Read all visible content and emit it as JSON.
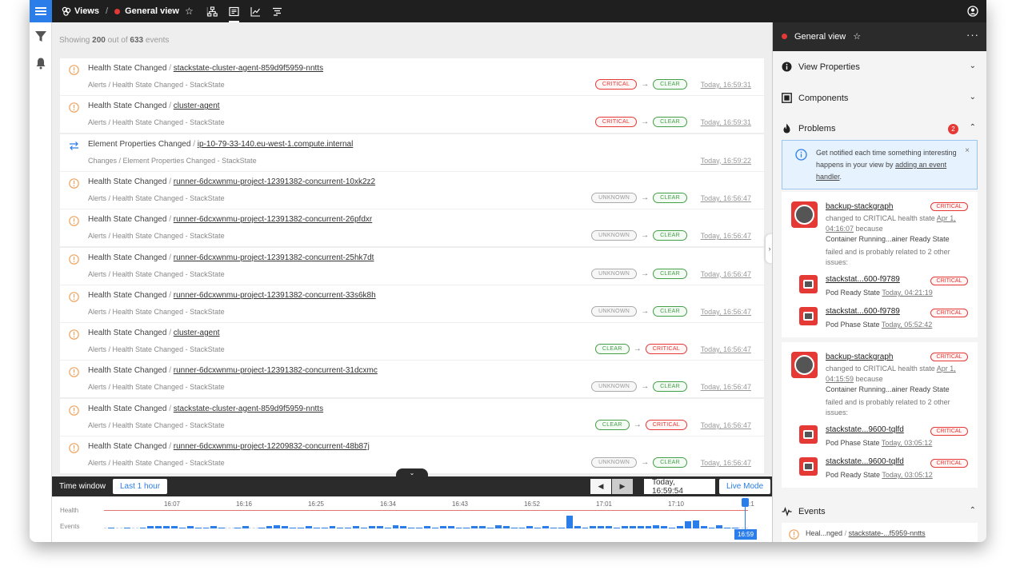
{
  "topbar": {
    "views_label": "Views",
    "separator": "/",
    "view_name": "General view",
    "divider": "|"
  },
  "main": {
    "showing_prefix": "Showing",
    "showing_count": "200",
    "showing_mid": "out of",
    "showing_total": "633",
    "showing_suffix": "events",
    "events": [
      {
        "icon": "warning-icon",
        "type": "Health State Changed",
        "sep": "/",
        "target": "stackstate-cluster-agent-859d9f5959-nntts",
        "subtitle": "Alerts / Health State Changed - StackState",
        "from": "CRITICAL",
        "arrow": "→",
        "to": "CLEAR",
        "time": "Today, 16:59:31"
      },
      {
        "icon": "warning-icon",
        "type": "Health State Changed",
        "sep": "/",
        "target": "cluster-agent",
        "subtitle": "Alerts / Health State Changed - StackState",
        "from": "CRITICAL",
        "arrow": "→",
        "to": "CLEAR",
        "time": "Today, 16:59:31"
      },
      {
        "icon": "swap-icon",
        "type": "Element Properties Changed",
        "sep": "/",
        "target": "ip-10-79-33-140.eu-west-1.compute.internal",
        "subtitle": "Changes / Element Properties Changed - StackState",
        "from": "",
        "arrow": "",
        "to": "",
        "time": "Today, 16:59:22"
      },
      {
        "icon": "warning-icon",
        "type": "Health State Changed",
        "sep": "/",
        "target": "runner-6dcxwnmu-project-12391382-concurrent-10xk2z2",
        "subtitle": "Alerts / Health State Changed - StackState",
        "from": "UNKNOWN",
        "arrow": "→",
        "to": "CLEAR",
        "time": "Today, 16:56:47"
      },
      {
        "icon": "warning-icon",
        "type": "Health State Changed",
        "sep": "/",
        "target": "runner-6dcxwnmu-project-12391382-concurrent-26pfdxr",
        "subtitle": "Alerts / Health State Changed - StackState",
        "from": "UNKNOWN",
        "arrow": "→",
        "to": "CLEAR",
        "time": "Today, 16:56:47"
      },
      {
        "icon": "warning-icon",
        "type": "Health State Changed",
        "sep": "/",
        "target": "runner-6dcxwnmu-project-12391382-concurrent-25hk7dt",
        "subtitle": "Alerts / Health State Changed - StackState",
        "from": "UNKNOWN",
        "arrow": "→",
        "to": "CLEAR",
        "time": "Today, 16:56:47"
      },
      {
        "icon": "warning-icon",
        "type": "Health State Changed",
        "sep": "/",
        "target": "runner-6dcxwnmu-project-12391382-concurrent-33s6k8h",
        "subtitle": "Alerts / Health State Changed - StackState",
        "from": "UNKNOWN",
        "arrow": "→",
        "to": "CLEAR",
        "time": "Today, 16:56:47"
      },
      {
        "icon": "warning-icon",
        "type": "Health State Changed",
        "sep": "/",
        "target": "cluster-agent",
        "subtitle": "Alerts / Health State Changed - StackState",
        "from": "CLEAR",
        "arrow": "→",
        "to": "CRITICAL",
        "time": "Today, 16:56:47"
      },
      {
        "icon": "warning-icon",
        "type": "Health State Changed",
        "sep": "/",
        "target": "runner-6dcxwnmu-project-12391382-concurrent-31dcxmc",
        "subtitle": "Alerts / Health State Changed - StackState",
        "from": "UNKNOWN",
        "arrow": "→",
        "to": "CLEAR",
        "time": "Today, 16:56:47"
      },
      {
        "icon": "warning-icon",
        "type": "Health State Changed",
        "sep": "/",
        "target": "stackstate-cluster-agent-859d9f5959-nntts",
        "subtitle": "Alerts / Health State Changed - StackState",
        "from": "CLEAR",
        "arrow": "→",
        "to": "CRITICAL",
        "time": "Today, 16:56:47"
      },
      {
        "icon": "warning-icon",
        "type": "Health State Changed",
        "sep": "/",
        "target": "runner-6dcxwnmu-project-12209832-concurrent-48b87j",
        "subtitle": "Alerts / Health State Changed - StackState",
        "from": "UNKNOWN",
        "arrow": "→",
        "to": "CLEAR",
        "time": "Today, 16:56:47"
      }
    ]
  },
  "timewindow": {
    "label": "Time window",
    "range": "Last 1 hour",
    "current_time": "Today, 16:59:54",
    "mode": "Live Mode",
    "prev": "◀",
    "next": "▶",
    "collapse": "⌄"
  },
  "timeline": {
    "health_label": "Health",
    "events_label": "Events",
    "ticks": [
      "16:07",
      "16:16",
      "16:25",
      "16:34",
      "16:43",
      "16:52",
      "17:01",
      "17:10",
      "17:1"
    ],
    "cursor_time": "16:59",
    "event_counts": [
      1,
      0,
      1,
      0,
      1,
      2,
      2,
      2,
      2,
      1,
      2,
      1,
      1,
      2,
      1,
      0,
      1,
      2,
      0,
      1,
      2,
      3,
      2,
      1,
      1,
      2,
      1,
      1,
      2,
      1,
      1,
      2,
      1,
      2,
      2,
      1,
      3,
      2,
      1,
      1,
      2,
      1,
      2,
      2,
      1,
      1,
      2,
      2,
      1,
      3,
      2,
      1,
      1,
      2,
      1,
      2,
      1,
      1,
      12,
      2,
      1,
      2,
      2,
      2,
      1,
      2,
      2,
      2,
      2,
      3,
      2,
      1,
      2,
      7,
      8,
      2,
      1,
      3,
      1,
      1
    ]
  },
  "panel": {
    "view_name": "General view",
    "more": "···",
    "sections": {
      "view_properties": "View Properties",
      "components": "Components",
      "problems": "Problems",
      "problems_count": "2",
      "events": "Events"
    },
    "notice": {
      "text": "Get notified each time something interesting happens in your view by",
      "link": "adding an event handler",
      "end": ".",
      "close": "×"
    },
    "problems": [
      {
        "name": "backup-stackgraph",
        "badge": "CRITICAL",
        "line1": "changed to CRITICAL health state",
        "time": "Apr 1, 04:16:07",
        "because": "because",
        "check": "Container Running...ainer Ready State",
        "line3": "failed and is probably related to 2 other issues:",
        "related": [
          {
            "name": "stackstat...600-f9789",
            "badge": "CRITICAL",
            "state": "Pod Ready State",
            "time": "Today, 04:21:19"
          },
          {
            "name": "stackstat...600-f9789",
            "badge": "CRITICAL",
            "state": "Pod Phase State",
            "time": "Today, 05:52:42"
          }
        ]
      },
      {
        "name": "backup-stackgraph",
        "badge": "CRITICAL",
        "line1": "changed to CRITICAL health state",
        "time": "Apr 1, 04:15:59",
        "because": "because",
        "check": "Container Running...ainer Ready State",
        "line3": "failed and is probably related to 2 other issues:",
        "related": [
          {
            "name": "stackstate...9600-tqlfd",
            "badge": "CRITICAL",
            "state": "Pod Phase State",
            "time": "Today, 03:05:12"
          },
          {
            "name": "stackstate...9600-tqlfd",
            "badge": "CRITICAL",
            "state": "Pod Ready State",
            "time": "Today, 03:05:12"
          }
        ]
      }
    ],
    "event_preview": {
      "type": "Heal...nged",
      "sep": "/",
      "target": "stackstate-...f5959-nntts"
    }
  },
  "colors": {
    "accent": "#2b7de9",
    "critical": "#e53935",
    "clear": "#43a047",
    "unknown": "#999999",
    "warning": "#f0a35e",
    "topbar": "#1f1f1f"
  }
}
